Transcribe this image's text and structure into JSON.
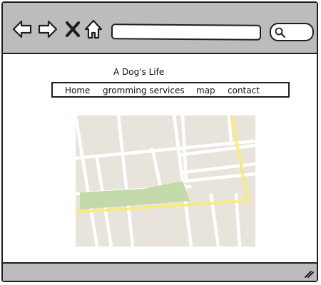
{
  "browser": {
    "back_icon": "back-arrow-icon",
    "forward_icon": "forward-arrow-icon",
    "stop_icon": "close-x-icon",
    "home_icon": "home-icon",
    "address_value": "",
    "search_icon": "magnifier-icon"
  },
  "page": {
    "title": "A Dog's Life",
    "nav": [
      {
        "label": "Home"
      },
      {
        "label": "gromming services"
      },
      {
        "label": "map"
      },
      {
        "label": "contact"
      }
    ],
    "map_image": "street-map-placeholder"
  },
  "colors": {
    "chrome": "#bcbcbc",
    "map_land": "#e8e4dc",
    "map_street": "#ffffff",
    "map_highway": "#fbec6a",
    "map_park": "#c3d9a9"
  }
}
